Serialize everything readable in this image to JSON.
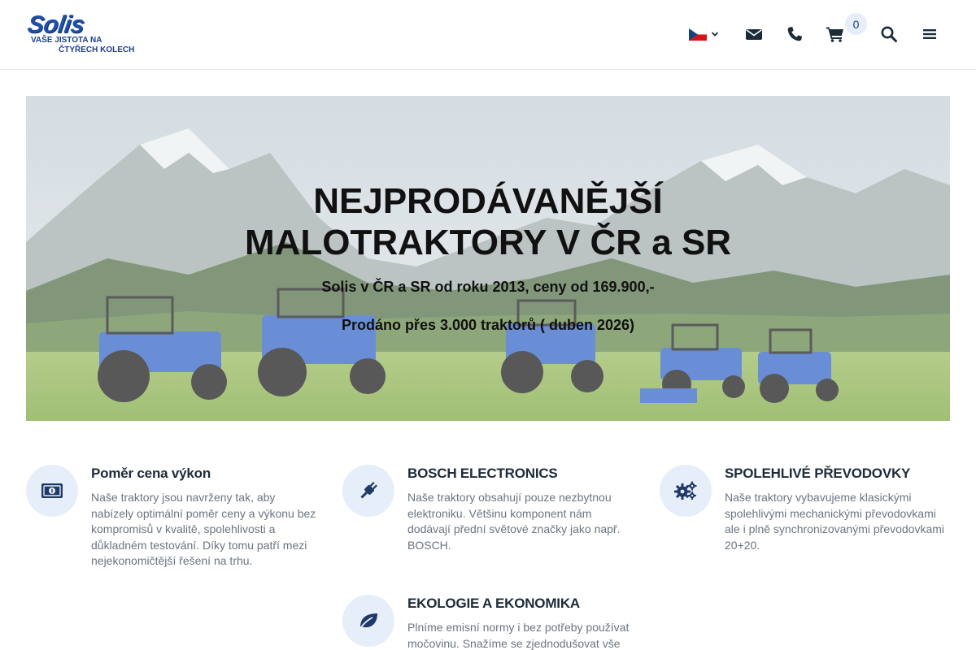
{
  "header": {
    "logo": {
      "word": "Solis",
      "line1": "VAŠE JISTOTA NA",
      "line2": "ČTYŘECH KOLECH"
    },
    "icons": [
      "flag-cz-icon",
      "chevron-down-icon",
      "envelope-icon",
      "phone-icon",
      "cart-icon",
      "search-icon",
      "menu-icon"
    ],
    "cart_count": "0"
  },
  "hero": {
    "title_line1": "NEJPRODÁVANĚJŠÍ",
    "title_line2": "MALOTRAKTORY V ČR a SR",
    "subtitle1": "Solis v ČR a SR od roku 2013, ceny od  169.900,-",
    "subtitle2": "Prodáno přes 3.000 traktorů ( duben 2026)"
  },
  "features": [
    {
      "icon": "money-bill-icon",
      "title": "Poměr cena výkon",
      "text": "Naše traktory jsou navrženy tak, aby nabízely optimální poměr ceny a výkonu bez kompromisů v kvalitě, spolehlivosti a důkladném testování. Díky tomu patří mezi nejekonomičtější řešení na trhu."
    },
    {
      "icon": "plug-icon",
      "title": "BOSCH ELECTRONICS",
      "text": "Naše traktory obsahují pouze nezbytnou elektroniku. Většinu komponent nám dodávají přední světové značky jako např. BOSCH."
    },
    {
      "icon": "cogs-icon",
      "title": "SPOLEHLIVÉ PŘEVODOVKY",
      "text": "Naše traktory vybavujeme klasickými spolehlivými mechanickými převodovkami ale i plně synchronizovanými převodovkami 20+20."
    },
    {
      "icon": "leaf-icon",
      "title": "EKOLOGIE A EKONOMIKA",
      "text": "Plníme emisní normy i bez potřeby používat močovinu. Snažíme se zjednodušovat vše"
    }
  ],
  "colors": {
    "brand_blue": "#1f4fa8",
    "icon_bg": "#e6eef9",
    "icon_fg": "#1f3a68",
    "text_muted": "#6b7480"
  }
}
